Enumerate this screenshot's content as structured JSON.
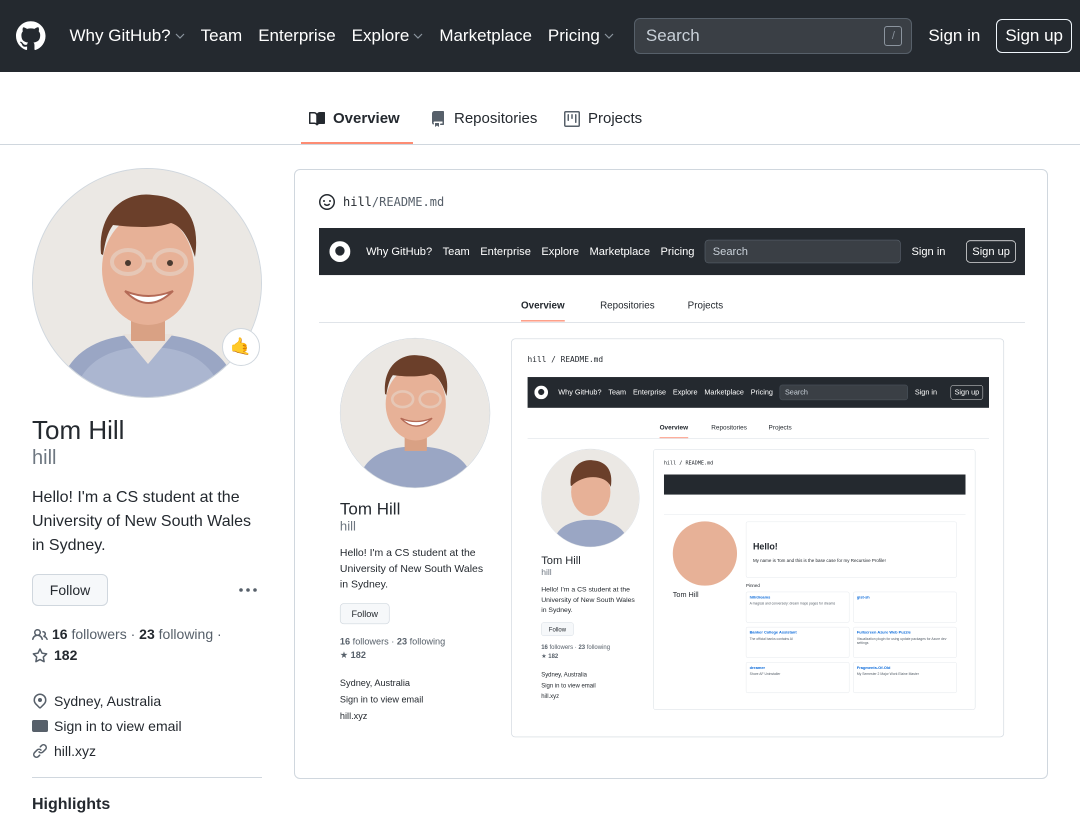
{
  "header": {
    "nav": [
      {
        "label": "Why GitHub?",
        "dropdown": true
      },
      {
        "label": "Team",
        "dropdown": false
      },
      {
        "label": "Enterprise",
        "dropdown": false
      },
      {
        "label": "Explore",
        "dropdown": true
      },
      {
        "label": "Marketplace",
        "dropdown": false
      },
      {
        "label": "Pricing",
        "dropdown": true
      }
    ],
    "search_placeholder": "Search",
    "search_shortcut": "/",
    "sign_in": "Sign in",
    "sign_up": "Sign up"
  },
  "tabs": [
    {
      "label": "Overview",
      "icon": "book-icon",
      "active": true
    },
    {
      "label": "Repositories",
      "icon": "repo-icon",
      "active": false
    },
    {
      "label": "Projects",
      "icon": "project-icon",
      "active": false
    }
  ],
  "profile": {
    "name": "Tom Hill",
    "login": "hill",
    "status_emoji": "🤙",
    "bio": "Hello! I'm a CS student at the University of New South Wales in Sydney.",
    "follow_label": "Follow",
    "more_label": "···",
    "followers_count": "16",
    "followers_label": "followers",
    "following_count": "23",
    "following_label": "following",
    "separator": "·",
    "stars_count": "182",
    "location": "Sydney, Australia",
    "email": "Sign in to view email",
    "website": "hill.xyz",
    "highlights_heading": "Highlights"
  },
  "readme": {
    "owner": "hill",
    "path_sep": "/",
    "file": "README.md"
  },
  "deep": {
    "hello": "Hello!",
    "intro": "My name is Tom and this is the base case for my Recursive Profile!",
    "pinned": "Pinned",
    "cards": [
      {
        "title": "hill/dreams",
        "desc": "A magical and conversely: dream maps pages for dreams"
      },
      {
        "title": "gist-sh",
        "desc": ""
      },
      {
        "title": "Banker College Assistant",
        "desc": "The official banks contains Al"
      },
      {
        "title": "Fullscreen Azure Web Puzzle",
        "desc": "Visualization plugin for using update packages for Azure dev settings"
      },
      {
        "title": "dreamer",
        "desc": "Shore AF Uninstaller"
      },
      {
        "title": "Fragments-Of-Old",
        "desc": "My Semester 2 Major Work Elaine Master"
      }
    ]
  }
}
